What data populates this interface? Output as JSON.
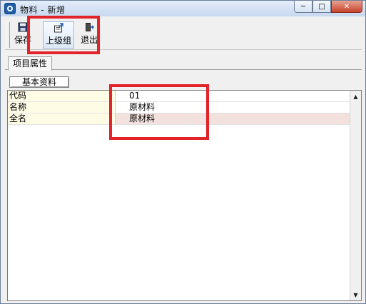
{
  "window": {
    "title": "物料 - 新增",
    "min_glyph": "─",
    "max_glyph": "□",
    "close_glyph": "✕"
  },
  "toolbar": {
    "save_label": "保存",
    "parent_group_label": "上级组",
    "exit_label": "退出"
  },
  "tabs": {
    "main_tab": "项目属性",
    "sub_tab": "基本资料"
  },
  "grid": {
    "rows": [
      {
        "label": "代码",
        "value": "01"
      },
      {
        "label": "名称",
        "value": "原材料"
      },
      {
        "label": "全名",
        "value": "原材料"
      }
    ],
    "scroll_up_glyph": "▲",
    "scroll_down_glyph": "▼"
  },
  "colors": {
    "highlight": "#e2232a",
    "label_bg": "#fffce6",
    "readonly_bg": "#f3e1de"
  },
  "icons": {
    "app": "app-logo-icon",
    "save": "floppy-disk-icon",
    "parent_group": "folder-up-icon",
    "exit": "door-exit-icon"
  }
}
